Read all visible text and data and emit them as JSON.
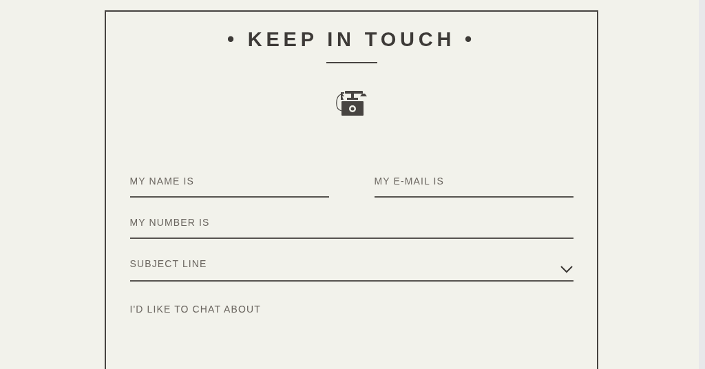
{
  "title": "• KEEP IN TOUCH •",
  "form_rows": [
    [
      {
        "kind": "text",
        "placeholder": "MY NAME IS"
      },
      {
        "kind": "text",
        "placeholder": "MY E-MAIL IS"
      }
    ],
    [
      {
        "kind": "text",
        "placeholder": "MY NUMBER IS"
      }
    ],
    [
      {
        "kind": "select",
        "value": "SUBJECT LINE"
      }
    ],
    [
      {
        "kind": "textarea",
        "placeholder": "I'D LIKE TO CHAT ABOUT"
      }
    ]
  ]
}
